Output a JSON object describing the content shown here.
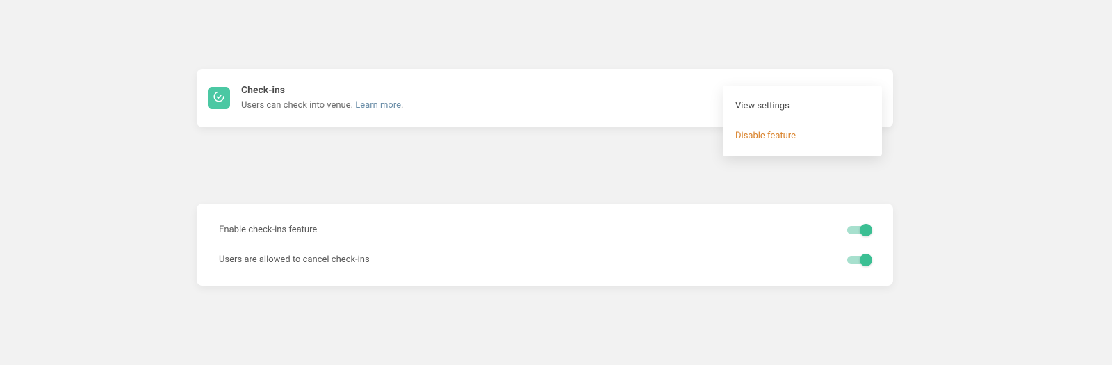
{
  "header": {
    "title": "Check-ins",
    "description": "Users can check into venue.",
    "learn_more": "Learn more",
    "period": "."
  },
  "menu": {
    "view_settings": "View settings",
    "disable_feature": "Disable feature"
  },
  "settings": [
    {
      "label": "Enable check-ins feature",
      "enabled": true
    },
    {
      "label": "Users are allowed to cancel check-ins",
      "enabled": true
    }
  ],
  "colors": {
    "accent": "#3bbf93",
    "icon_bg": "#4bc8a3",
    "danger": "#d9822b",
    "link": "#6b8ea8"
  }
}
